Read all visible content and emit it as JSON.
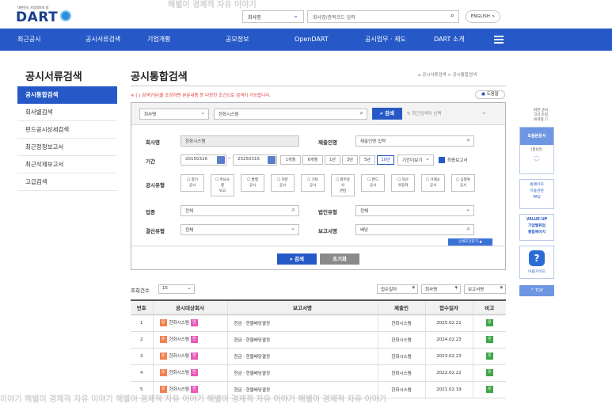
{
  "watermark": {
    "top": "해별이 경제적 자유 이야기",
    "bottom": "이야기  해별이 경제적 자유 이야기  해별이 경제적 자유 이야기  해별이 경제적 자유 이야기  해별이 경제적 자유 이야기"
  },
  "header": {
    "logo_small": "대한민국 기업정보의 창",
    "logo": "DART",
    "search_scope": "회사명",
    "search_placeholder": "회사명/종목코드 입력",
    "english_label": "ENGLISH >"
  },
  "nav": {
    "items": [
      "최근공시",
      "공시서류검색",
      "기업개황",
      "공모정보",
      "OpenDART",
      "공시업무 · 제도",
      "DART 소개"
    ]
  },
  "sidebar": {
    "title": "공시서류검색",
    "items": [
      "공시통합검색",
      "회사별검색",
      "펀드공시상세검색",
      "최근정정보고서",
      "최근삭제보고서",
      "고급검색"
    ]
  },
  "main": {
    "title": "공시통합검색",
    "breadcrumb": "공시서류검색 > 공시통합검색",
    "notice": "※ [ ] 검색구분]을 조정하면 본문내용 등 다양한 조건으로 검색이 가능합니다.",
    "help_label": "도움말"
  },
  "search": {
    "scope": "회사명",
    "query": "한화시스템",
    "button": "검색",
    "recent": "최근검색어 선택",
    "company_label": "회사명",
    "company_value": "한화시스템",
    "submitter_label": "제출인명",
    "submitter_placeholder": "제출인명 입력",
    "period_label": "기간",
    "date_from": "20150316",
    "date_to": "20250316",
    "period_chips": [
      "1개월",
      "6개월",
      "1년",
      "3년",
      "5년",
      "10년"
    ],
    "period_other": "기간더보기",
    "final_report": "최종보고서",
    "type_label": "공시유형",
    "types": [
      [
        "정기",
        "공시"
      ],
      [
        "주요사",
        "항",
        "보고"
      ],
      [
        "발행",
        "공시"
      ],
      [
        "지분",
        "공시"
      ],
      [
        "기타",
        "공시"
      ],
      [
        "외부감",
        "사",
        "관련"
      ],
      [
        "펀드",
        "공시"
      ],
      [
        "자산",
        "유동화"
      ],
      [
        "거래소",
        "공시"
      ],
      [
        "공정위",
        "공시"
      ]
    ],
    "industry_label": "업종",
    "industry_value": "전체",
    "corp_type_label": "법인유형",
    "corp_type_value": "전체",
    "settlement_label": "결산유형",
    "settlement_value": "전체",
    "report_label": "보고서명",
    "report_value": "배당",
    "detail_button": "상세조건닫기 ▲",
    "submit": "검색",
    "reset": "초기화"
  },
  "results": {
    "count_label": "조회건수",
    "count_value": "15",
    "sorts": [
      "접수일자",
      "회사명",
      "보고서명"
    ],
    "columns": [
      "번호",
      "공시대상회사",
      "보고서명",
      "제출인",
      "접수일자",
      "비고"
    ],
    "rows": [
      {
        "no": "1",
        "company": "한화시스템",
        "report": "현금ㆍ현물배당결정",
        "submitter": "한화시스템",
        "date": "2025.02.21"
      },
      {
        "no": "2",
        "company": "한화시스템",
        "report": "현금ㆍ현물배당결정",
        "submitter": "한화시스템",
        "date": "2024.02.23"
      },
      {
        "no": "3",
        "company": "한화시스템",
        "report": "현금ㆍ현물배당결정",
        "submitter": "한화시스템",
        "date": "2023.02.23"
      },
      {
        "no": "4",
        "company": "한화시스템",
        "report": "현금ㆍ현물배당결정",
        "submitter": "한화시스템",
        "date": "2022.02.22"
      },
      {
        "no": "5",
        "company": "한화시스템",
        "report": "현금ㆍ현물배당결정",
        "submitter": "한화시스템",
        "date": "2021.02.19"
      }
    ],
    "badge_a": "유",
    "badge_b": "연",
    "note_badge": "유"
  },
  "rail": {
    "font_label": "화면 글씨\n크기 조정",
    "mode_label": "UI과형",
    "recent_docs": "모음본문서",
    "recent_count": "(총0건)",
    "homepage": "홈페이지\n이용관련\nFAQ",
    "valueup": "VALUE-UP\n기업밸류업\n통합페이지",
    "guide": "이용가이드",
    "top": "^ TOP"
  },
  "colors": {
    "brand": "#2659c7",
    "notice": "#e03a3a"
  }
}
